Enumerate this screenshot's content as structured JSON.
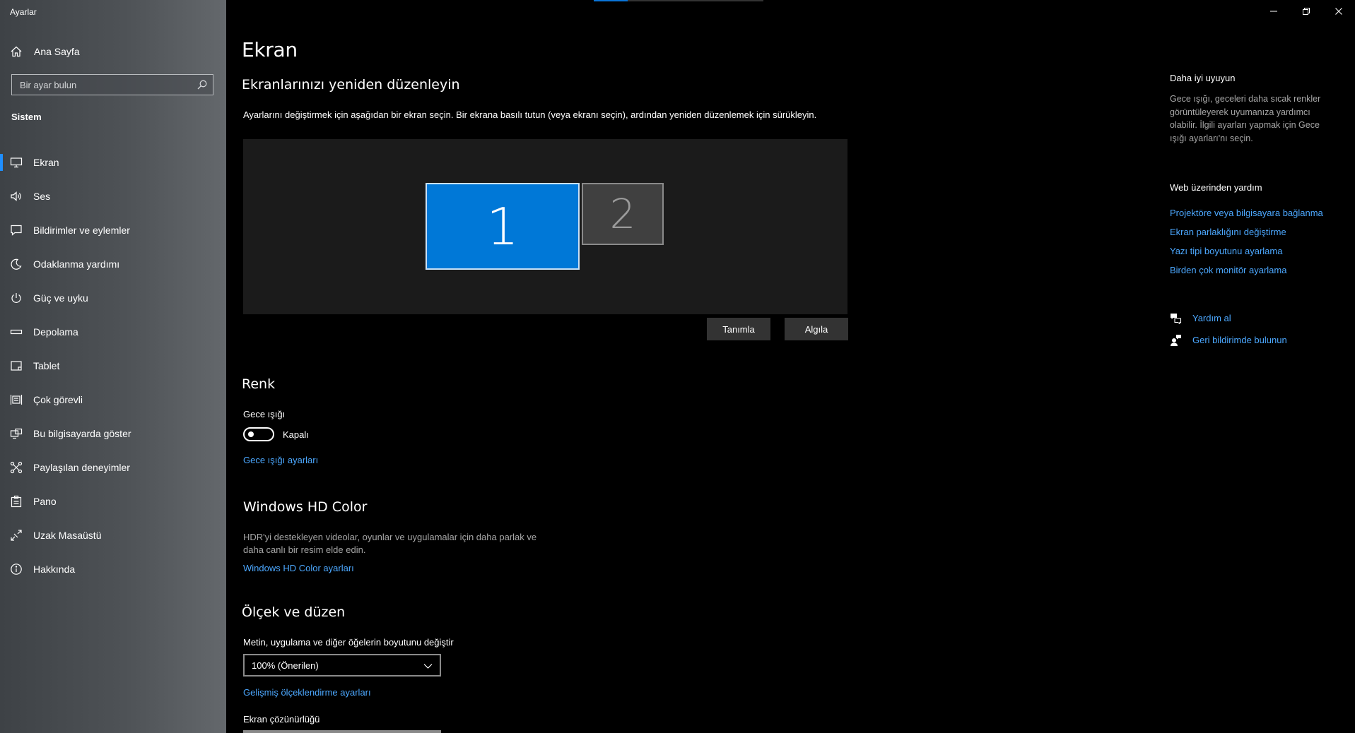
{
  "window": {
    "title": "Ayarlar",
    "controls": {
      "minimize": "minimize",
      "restore": "restore",
      "close": "close"
    }
  },
  "sidebar": {
    "home_label": "Ana Sayfa",
    "search_placeholder": "Bir ayar bulun",
    "section": "Sistem",
    "items": [
      {
        "label": "Ekran",
        "icon": "monitor-icon",
        "active": true
      },
      {
        "label": "Ses",
        "icon": "speaker-icon"
      },
      {
        "label": "Bildirimler ve eylemler",
        "icon": "notification-icon"
      },
      {
        "label": "Odaklanma yardımı",
        "icon": "moon-icon"
      },
      {
        "label": "Güç ve uyku",
        "icon": "power-icon"
      },
      {
        "label": "Depolama",
        "icon": "storage-icon"
      },
      {
        "label": "Tablet",
        "icon": "tablet-icon"
      },
      {
        "label": "Çok görevli",
        "icon": "multitasking-icon"
      },
      {
        "label": "Bu bilgisayarda göster",
        "icon": "project-icon"
      },
      {
        "label": "Paylaşılan deneyimler",
        "icon": "shared-icon"
      },
      {
        "label": "Pano",
        "icon": "clipboard-icon"
      },
      {
        "label": "Uzak Masaüstü",
        "icon": "remote-desktop-icon"
      },
      {
        "label": "Hakkında",
        "icon": "info-icon"
      }
    ]
  },
  "main": {
    "title": "Ekran",
    "arrange": {
      "heading": "Ekranlarınızı yeniden düzenleyin",
      "description": "Ayarlarını değiştirmek için aşağıdan bir ekran seçin. Bir ekrana basılı tutun (veya ekranı seçin), ardından yeniden düzenlemek için sürükleyin.",
      "monitor_1": "1",
      "monitor_2": "2",
      "identify_button": "Tanımla",
      "detect_button": "Algıla"
    },
    "color": {
      "heading": "Renk",
      "night_light_label": "Gece ışığı",
      "toggle_state": "Kapalı",
      "night_light_link": "Gece ışığı ayarları"
    },
    "hdr": {
      "heading": "Windows HD Color",
      "description_line1": "HDR'yi destekleyen videolar, oyunlar ve uygulamalar için daha parlak ve",
      "description_line2": "daha canlı bir resim elde edin.",
      "link": "Windows HD Color ayarları"
    },
    "scale": {
      "heading": "Ölçek ve düzen",
      "size_label": "Metin, uygulama ve diğer öğelerin boyutunu değiştir",
      "size_value": "100% (Önerilen)",
      "advanced_link": "Gelişmiş ölçeklendirme ayarları",
      "resolution_label": "Ekran çözünürlüğü"
    }
  },
  "right_panel": {
    "sleep_heading": "Daha iyi uyuyun",
    "sleep_text_1": "Gece ışığı, geceleri daha sıcak renkler",
    "sleep_text_2": "görüntüleyerek uyumanıza yardımcı",
    "sleep_text_3": "olabilir. İlgili ayarları yapmak için Gece",
    "sleep_text_4": "ışığı ayarları'nı seçin.",
    "web_help_heading": "Web üzerinden yardım",
    "links": [
      "Projektöre veya bilgisayara bağlanma",
      "Ekran parlaklığını değiştirme",
      "Yazı tipi boyutunu ayarlama",
      "Birden çok monitör ayarlama"
    ],
    "get_help": "Yardım al",
    "feedback": "Geri bildirimde bulunun"
  },
  "colors": {
    "accent": "#0078d7",
    "link": "#4ca8ff",
    "background": "#000000",
    "sidebar": "#4e5256"
  }
}
